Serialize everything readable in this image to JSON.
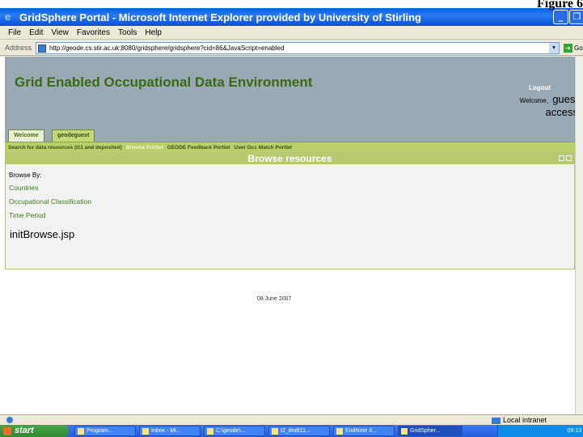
{
  "figure_label": "Figure 6",
  "window": {
    "title": "GridSphere Portal - Microsoft Internet Explorer provided by University of Stirling"
  },
  "menu": [
    "File",
    "Edit",
    "View",
    "Favorites",
    "Tools",
    "Help"
  ],
  "address": {
    "label": "Address",
    "url": "http://geode.cs.stir.ac.uk:8080/gridsphere/gridsphere?cid=86&JavaScript=enabled",
    "go": "Go"
  },
  "header": {
    "title": "Grid Enabled Occupational Data Environment",
    "logout": "Logout",
    "welcome": "Welcome,",
    "user": "guest access"
  },
  "tabs": [
    "Welcome",
    "geodeguest"
  ],
  "subtabs": [
    "Search for data resources (G1 and deposited)",
    "Browse Portlet",
    "GEODE Feedback Portlet",
    "User Occ Match Portlet"
  ],
  "portlet": {
    "title": "Browse resources",
    "browse_by": "Browse By:",
    "links": [
      "Countries",
      "Occupational Classification",
      "Time Period"
    ],
    "jsp": "initBrowse.jsp"
  },
  "footer_date": "08 June 2007",
  "status": {
    "zone": "Local intranet"
  },
  "taskbar": {
    "start": "start",
    "items": [
      "Program...",
      "Inbox - Mi...",
      "C:\\geode\\...",
      "t2_draft11...",
      "EndNote X...",
      "GridSpher..."
    ],
    "clock": "09:13"
  }
}
